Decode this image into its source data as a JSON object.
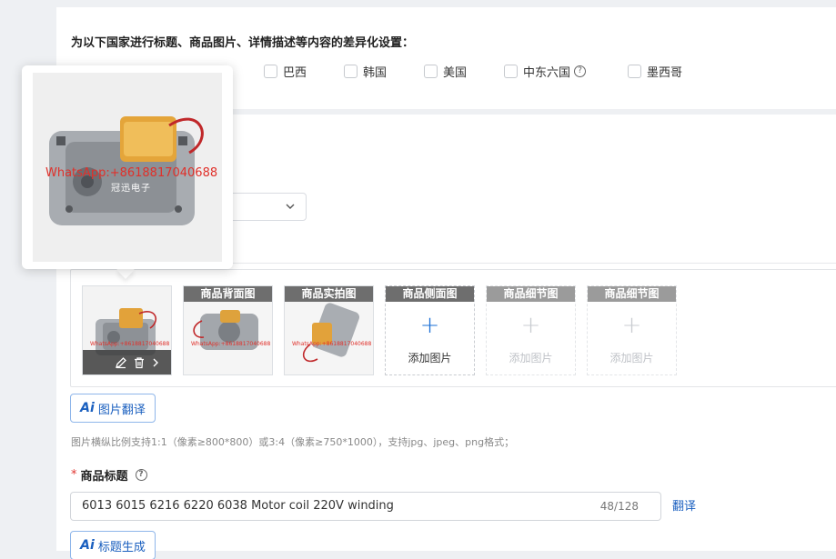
{
  "settings": {
    "label": "为以下国家进行标题、商品图片、详情描述等内容的差异化设置：",
    "countries": [
      "巴西",
      "韩国",
      "美国",
      "中东六国",
      "墨西哥"
    ]
  },
  "images": {
    "slots": [
      {
        "label": "商品背面图",
        "state": "filled"
      },
      {
        "label": "商品实拍图",
        "state": "filled"
      },
      {
        "label": "商品侧面图",
        "state": "empty",
        "add_label": "添加图片"
      },
      {
        "label": "商品细节图",
        "state": "disabled",
        "add_label": "添加图片"
      },
      {
        "label": "商品细节图",
        "state": "disabled",
        "add_label": "添加图片"
      }
    ],
    "watermark": "WhatsApp:+8618817040688",
    "translate_button": "图片翻译",
    "hint": "图片横纵比例支持1:1（像素≥800*800）或3:4（像素≥750*1000），支持jpg、jpeg、png格式；"
  },
  "title": {
    "label": "商品标题",
    "required_mark": "*",
    "value": "6013 6015 6216 6220 6038 Motor coil 220V winding",
    "counter": "48/128",
    "translate_link": "翻译",
    "generate_button": "标题生成"
  },
  "popover": {
    "watermark": "WhatsApp:+8618817040688",
    "brand_text": "冠迅电子"
  },
  "colors": {
    "accent": "#1a5fbf",
    "required": "#e0342f",
    "watermark": "#e0302a"
  }
}
